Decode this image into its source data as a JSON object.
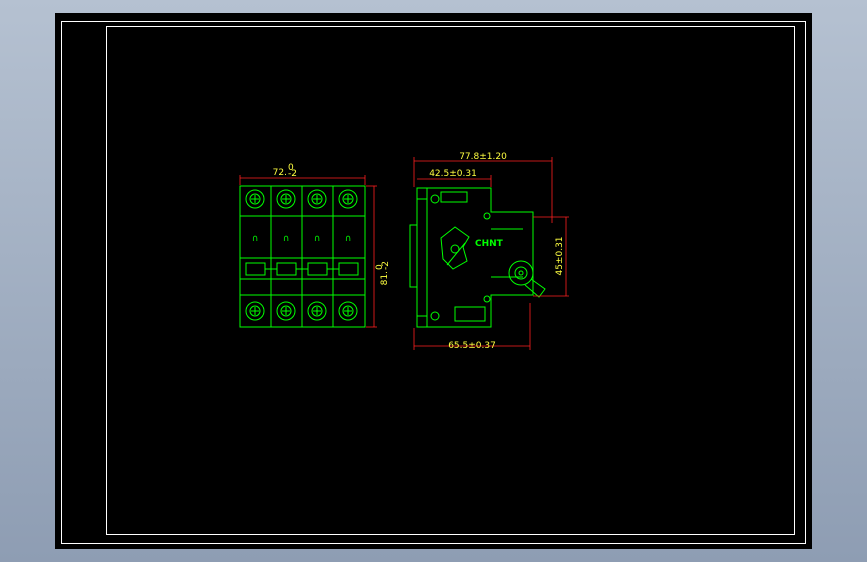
{
  "drawing": {
    "dimensions": {
      "front_width": "72.",
      "front_width_tol_upper": "0",
      "front_width_tol_lower": "-2",
      "front_height": "81.",
      "front_height_tol_upper": "0",
      "front_height_tol_lower": "-2",
      "side_total_depth": "77.8±1.20",
      "side_upper_depth": "42.5±0.31",
      "side_rail_height": "45±0.31",
      "side_base_depth": "65.5±0.37"
    },
    "brand_label": "CHNT",
    "front_pole_marks": [
      "∩",
      "∩",
      "∩",
      "∩"
    ]
  },
  "colors": {
    "sheet_background": "#000000",
    "border": "#ffffff",
    "outline": "#00ff00",
    "dimension_line": "#ff2020",
    "dimension_text": "#ffff40"
  }
}
